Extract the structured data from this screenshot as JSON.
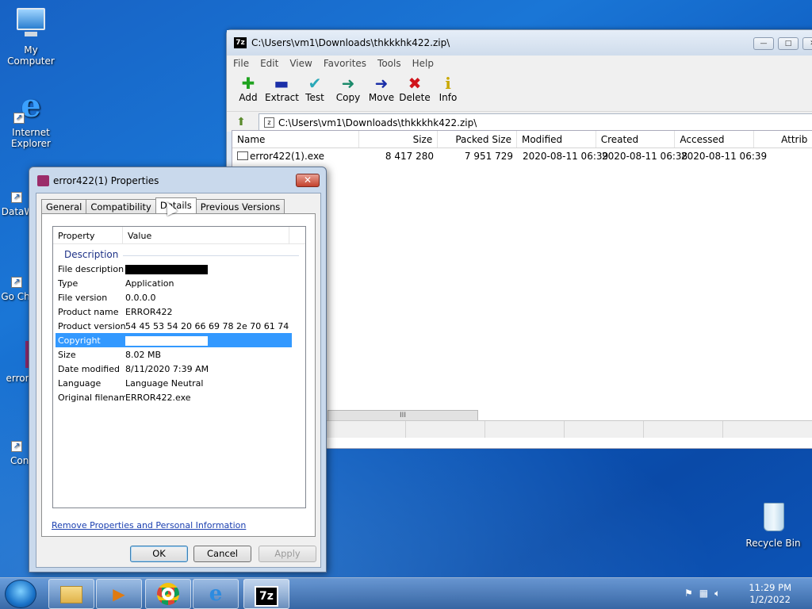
{
  "desktop": {
    "icons": [
      {
        "label": "My Computer"
      },
      {
        "label": "Internet Explorer"
      },
      {
        "label": "DataW"
      },
      {
        "label": "Go Chr"
      },
      {
        "label": "error"
      },
      {
        "label": "Con Ja"
      },
      {
        "label": "Recycle Bin"
      }
    ]
  },
  "sevenzip": {
    "title": "C:\\Users\\vm1\\Downloads\\thkkkhk422.zip\\",
    "app_icon": "7z",
    "menu": [
      "File",
      "Edit",
      "View",
      "Favorites",
      "Tools",
      "Help"
    ],
    "toolbar": [
      {
        "label": "Add",
        "icon": "plus-icon",
        "glyph": "+",
        "color": "#1fa31f"
      },
      {
        "label": "Extract",
        "icon": "minus-icon",
        "glyph": "—",
        "color": "#1b2fa8"
      },
      {
        "label": "Test",
        "icon": "check-icon",
        "glyph": "✓",
        "color": "#2aa8b8"
      },
      {
        "label": "Copy",
        "icon": "copy-arrow-icon",
        "glyph": "➜",
        "color": "#1b8a6b"
      },
      {
        "label": "Move",
        "icon": "move-arrow-icon",
        "glyph": "➜",
        "color": "#1b2fa8"
      },
      {
        "label": "Delete",
        "icon": "delete-x-icon",
        "glyph": "✕",
        "color": "#d0141b"
      },
      {
        "label": "Info",
        "icon": "info-icon",
        "glyph": "i",
        "color": "#c9a800"
      }
    ],
    "address": "C:\\Users\\vm1\\Downloads\\thkkkhk422.zip\\",
    "columns": [
      "Name",
      "Size",
      "Packed Size",
      "Modified",
      "Created",
      "Accessed",
      "Attrib"
    ],
    "rows": [
      {
        "name": "error422(1).exe",
        "size": "8 417 280",
        "packed": "7 951 729",
        "modified": "2020-08-11 06:39",
        "created": "2020-08-11 06:38",
        "accessed": "2020-08-11 06:39"
      }
    ],
    "scroll_glyph": "III"
  },
  "properties": {
    "title": "error422(1) Properties",
    "close": "✕",
    "tabs": [
      "General",
      "Compatibility",
      "Details",
      "Previous Versions"
    ],
    "active_tab": "Details",
    "header": {
      "property": "Property",
      "value": "Value"
    },
    "group": "Description",
    "rows": [
      {
        "key": "File description",
        "value": ""
      },
      {
        "key": "Type",
        "value": "Application"
      },
      {
        "key": "File version",
        "value": "0.0.0.0"
      },
      {
        "key": "Product name",
        "value": "ERROR422"
      },
      {
        "key": "Product version",
        "value": "54 45 53 54 20 66 69 78 2e 70 61 74 6…"
      },
      {
        "key": "Copyright",
        "value": ""
      },
      {
        "key": "Size",
        "value": "8.02 MB"
      },
      {
        "key": "Date modified",
        "value": "8/11/2020 7:39 AM"
      },
      {
        "key": "Language",
        "value": "Language Neutral"
      },
      {
        "key": "Original filename",
        "value": "ERROR422.exe"
      }
    ],
    "link": "Remove Properties and Personal Information",
    "buttons": {
      "ok": "OK",
      "cancel": "Cancel",
      "apply": "Apply"
    }
  },
  "taskbar": {
    "apps": [
      {
        "icon": "explorer-folder-icon",
        "glyph": "🗂"
      },
      {
        "icon": "media-player-icon",
        "glyph": "▶"
      },
      {
        "icon": "chrome-icon",
        "glyph": "◉"
      },
      {
        "icon": "internet-explorer-icon",
        "glyph": "e"
      },
      {
        "icon": "7zip-icon",
        "glyph": "7z"
      }
    ],
    "time": "11:29 PM",
    "date": "1/2/2022"
  }
}
